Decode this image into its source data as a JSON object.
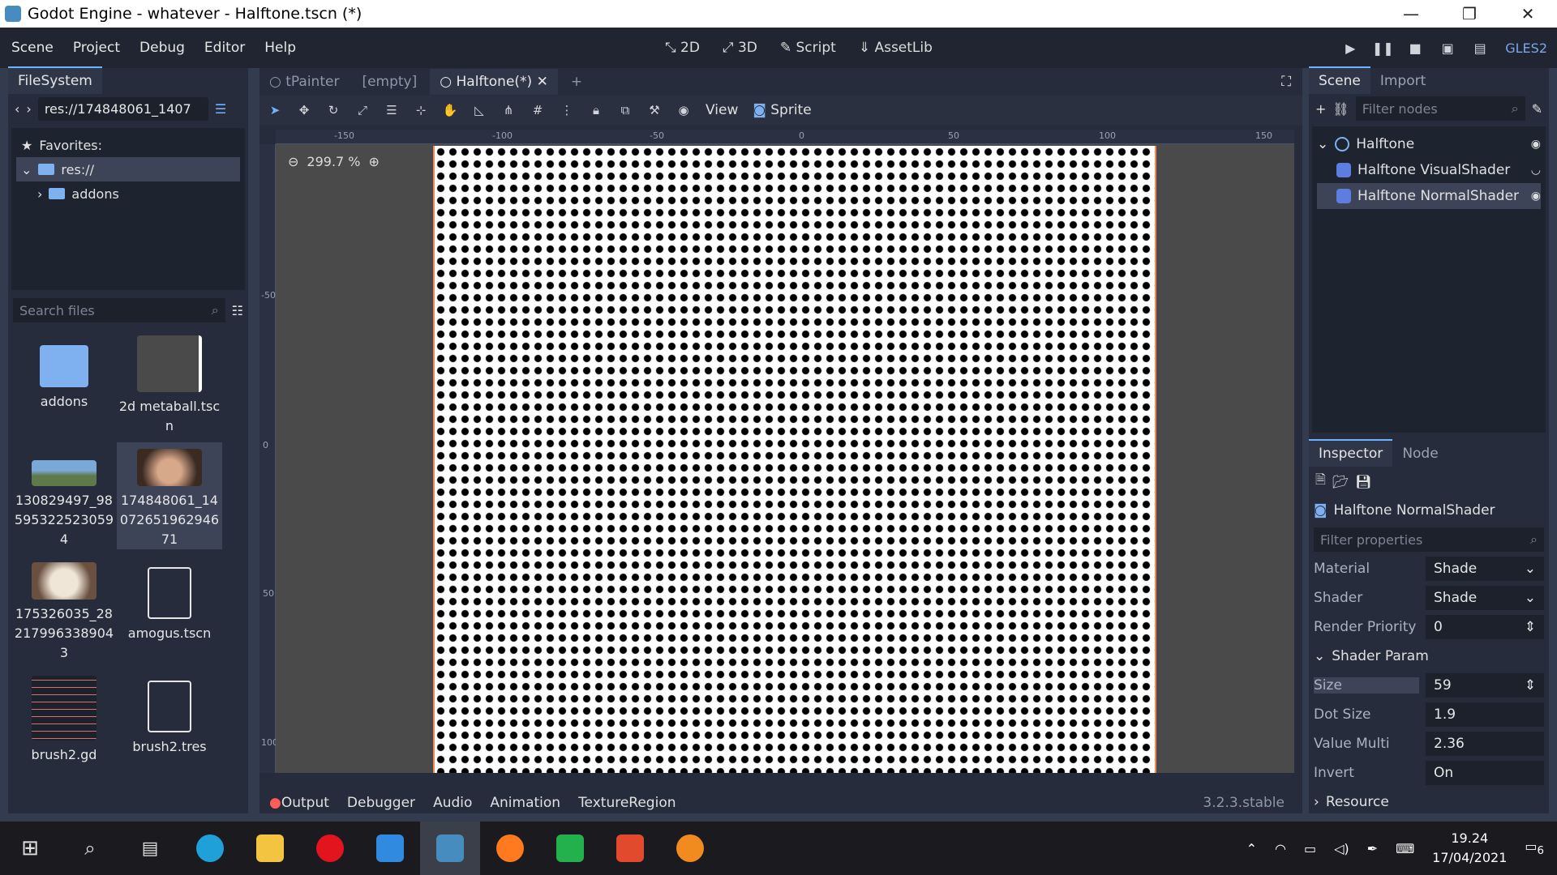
{
  "window": {
    "title": "Godot Engine - whatever - Halftone.tscn (*)",
    "minimize": "—",
    "restore": "❐",
    "close": "✕"
  },
  "menu": [
    "Scene",
    "Project",
    "Debug",
    "Editor",
    "Help"
  ],
  "modes": {
    "mode_2d": "2D",
    "mode_3d": "3D",
    "script": "Script",
    "assetlib": "AssetLib"
  },
  "renderer": "GLES2",
  "filesystem": {
    "tab": "FileSystem",
    "path": "res://174848061_1407",
    "favorites": "Favorites:",
    "root": "res://",
    "addons": "addons",
    "search_placeholder": "Search files",
    "items": [
      {
        "name": "addons"
      },
      {
        "name": "2d metaball.tscn"
      },
      {
        "name": "130829497_985953225230594"
      },
      {
        "name": "174848061_1407265196294671"
      },
      {
        "name": "175326035_282179963389043"
      },
      {
        "name": "amogus.tscn"
      },
      {
        "name": "brush2.gd"
      },
      {
        "name": "brush2.tres"
      }
    ]
  },
  "scene_tabs": [
    "tPainter",
    "[empty]",
    "Halftone(*)"
  ],
  "toolbar": {
    "view": "View",
    "sprite": "Sprite"
  },
  "zoom": "299.7 %",
  "ruler_h": [
    "-150",
    "-100",
    "-50",
    "0",
    "50",
    "100",
    "150"
  ],
  "ruler_v": [
    "-50",
    "0",
    "50",
    "100"
  ],
  "bottom_tabs": [
    "Output",
    "Debugger",
    "Audio",
    "Animation",
    "TextureRegion"
  ],
  "version": "3.2.3.stable",
  "scene_dock": {
    "tab_scene": "Scene",
    "tab_import": "Import",
    "filter_placeholder": "Filter nodes",
    "nodes": [
      "Halftone",
      "Halftone VisualShader",
      "Halftone NormalShader"
    ]
  },
  "inspector": {
    "tab_inspector": "Inspector",
    "tab_node": "Node",
    "object": "Halftone NormalShader",
    "filter_placeholder": "Filter properties",
    "material_label": "Material",
    "material_value": "Shade",
    "shader_label": "Shader",
    "shader_value": "Shade",
    "render_priority_label": "Render Priority",
    "render_priority_value": "0",
    "shader_param_label": "Shader Param",
    "size_label": "Size",
    "size_value": "59",
    "dot_size_label": "Dot Size",
    "dot_size_value": "1.9",
    "value_multi_label": "Value Multi",
    "value_multi_value": "2.36",
    "invert_label": "Invert",
    "invert_value": "On",
    "resource_label": "Resource"
  },
  "taskbar": {
    "time": "19.24",
    "date": "17/04/2021",
    "notifications": "6"
  }
}
